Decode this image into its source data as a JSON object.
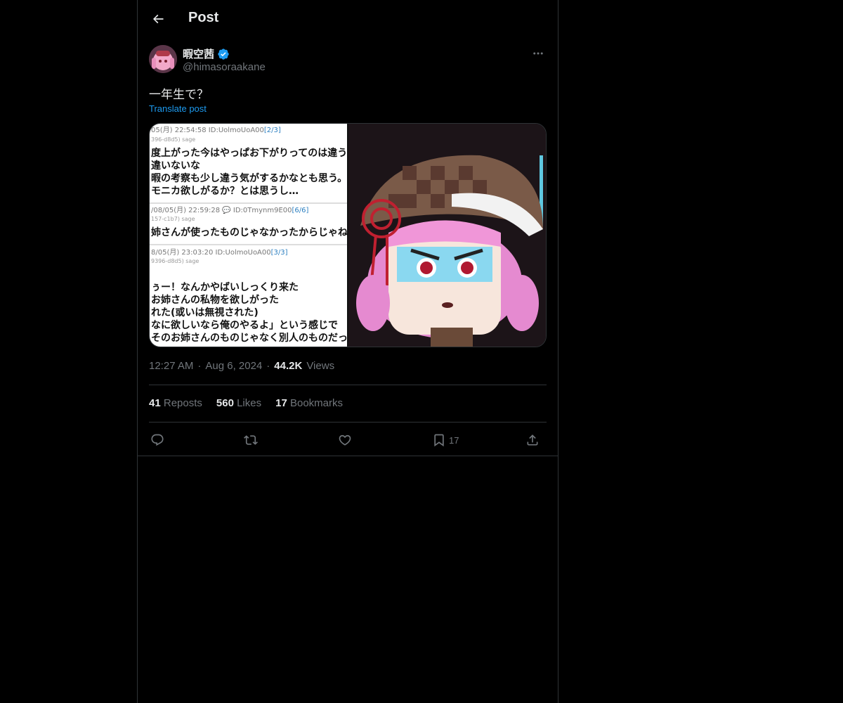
{
  "header": {
    "title": "Post"
  },
  "author": {
    "display_name": "暇空茜",
    "handle": "@himasoraakane"
  },
  "post": {
    "text": "一年生で？",
    "translate_label": "Translate post",
    "time": "12:27 AM",
    "date": "Aug 6, 2024",
    "views_count": "44.2K",
    "views_label": "Views"
  },
  "media": {
    "screenshot_lines": [
      {
        "meta": "05(月) 22:54:58  ID:UolmoUoA00",
        "ref": "[2/3]"
      },
      {
        "sub": "396-d8d5)  sage"
      },
      {
        "text": "度上がった今はやっぱお下がりってのは違う"
      },
      {
        "text": "違いないな"
      },
      {
        "text": "暇の考察も少し違う気がするかなとも思う。"
      },
      {
        "text": "モニカ欲しがるか？とは思うし…"
      },
      {
        "meta": "/08/05(月) 22:59:28  💬 ID:0Tmynm9E00",
        "ref": "[6/6]"
      },
      {
        "sub": "157-c1b7)  sage"
      },
      {
        "text": "姉さんが使ったものじゃなかったからじゃね"
      },
      {
        "meta": "8/05(月) 23:03:20  ID:UolmoUoA00",
        "ref": "[3/3]"
      },
      {
        "sub": "9396-d8d5)  sage"
      },
      {
        "text": "ぅー！なんかやばいしっくり来た"
      },
      {
        "text": "お姉さんの私物を欲しがった"
      },
      {
        "text": "れた(或いは無視された)"
      },
      {
        "text": "なに欲しいなら俺のやるよ」という感じで"
      },
      {
        "text": "そのお姉さんのものじゃなく別人のものだっ"
      }
    ]
  },
  "stats": {
    "reposts_count": "41",
    "reposts_label": "Reposts",
    "likes_count": "560",
    "likes_label": "Likes",
    "bookmarks_count": "17",
    "bookmarks_label": "Bookmarks"
  },
  "actions": {
    "bookmark_count": "17"
  },
  "colors": {
    "background": "#000000",
    "text": "#e7e9ea",
    "muted": "#71767b",
    "link": "#1d9bf0",
    "border": "#2f3336",
    "verified": "#1d9bf0"
  },
  "icons": [
    "arrow-left-icon",
    "verified-badge-icon",
    "more-icon",
    "reply-icon",
    "repost-icon",
    "like-icon",
    "bookmark-icon",
    "share-icon"
  ]
}
